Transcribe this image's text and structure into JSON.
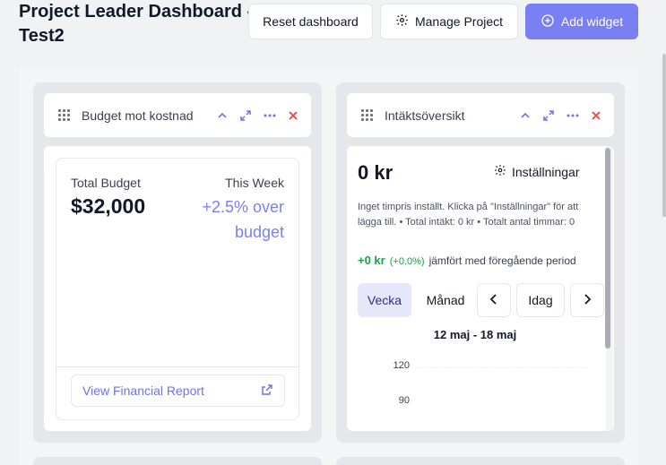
{
  "header": {
    "title": "Project Leader Dashboard - Test2",
    "reset_label": "Reset dashboard",
    "manage_label": "Manage Project",
    "add_label": "Add widget"
  },
  "budget_widget": {
    "title": "Budget mot kostnad",
    "total_label": "Total Budget",
    "total_value": "$32,000",
    "week_label": "This Week",
    "week_value": "+2.5% over budget",
    "report_link": "View Financial Report"
  },
  "revenue_widget": {
    "title": "Intäktsöversikt",
    "amount": "0 kr",
    "settings_label": "Inställningar",
    "info": "Inget timpris inställt. Klicka på \"Inställningar\" för att lägga till. • Total intäkt: 0 kr • Totalt antal timmar: 0",
    "change_amount": "+0 kr",
    "change_percent": "(+0.0%)",
    "change_text": "jämfört med föregående period",
    "tab_week": "Vecka",
    "tab_month": "Månad",
    "today_label": "Idag",
    "date_range": "12 maj - 18 maj",
    "ticks": [
      "120",
      "90"
    ]
  },
  "colors": {
    "accent": "#7b7ff4",
    "danger": "#ef4444",
    "positive": "#16a34a"
  },
  "icons": [
    "gear-icon",
    "plus-circle-icon",
    "drag-handle-icon",
    "chevron-up-icon",
    "expand-icon",
    "more-icon",
    "close-icon",
    "external-link-icon",
    "chevron-left-icon",
    "chevron-right-icon"
  ]
}
